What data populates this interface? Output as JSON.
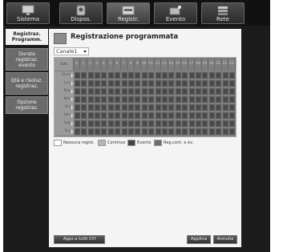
{
  "tabs": [
    {
      "label": "Sistema",
      "icon": "monitor-icon",
      "active": false
    },
    {
      "label": "Dispos.",
      "icon": "camera-icon",
      "active": false
    },
    {
      "label": "Registr.",
      "icon": "recorder-icon",
      "active": true
    },
    {
      "label": "Evento",
      "icon": "alarm-icon",
      "active": false
    },
    {
      "label": "Rete",
      "icon": "network-icon",
      "active": false
    }
  ],
  "menu": [
    {
      "label": "Registraz. Programm.",
      "active": true
    },
    {
      "label": "Durata registraz. evento",
      "active": false
    },
    {
      "label": "Qtà e risoluz. registraz.",
      "active": false
    },
    {
      "label": "Opzione registraz.",
      "active": false
    }
  ],
  "page": {
    "title": "Registrazione programmata",
    "channel": "Canale1"
  },
  "schedule": {
    "corner_label": "Tutti",
    "hours": [
      "0",
      "1",
      "2",
      "3",
      "4",
      "5",
      "6",
      "7",
      "8",
      "9",
      "10",
      "11",
      "12",
      "13",
      "14",
      "15",
      "16",
      "17",
      "18",
      "19",
      "20",
      "21",
      "22",
      "23"
    ],
    "days": [
      "Dom",
      "Lun",
      "Mar",
      "Mer",
      "Gio",
      "Ven",
      "Sab",
      "Fes"
    ]
  },
  "legend": [
    {
      "label": "Nessuna regist.",
      "color": "#ffffff"
    },
    {
      "label": "Continuo",
      "color": "#b5b5b5"
    },
    {
      "label": "Evento",
      "color": "#444444"
    },
    {
      "label": "Reg.cont. e ev.",
      "color": "#6e6e6e"
    }
  ],
  "buttons": {
    "apply_all": "Appl.a tutti CH",
    "apply": "Applica",
    "cancel": "Annulla"
  }
}
